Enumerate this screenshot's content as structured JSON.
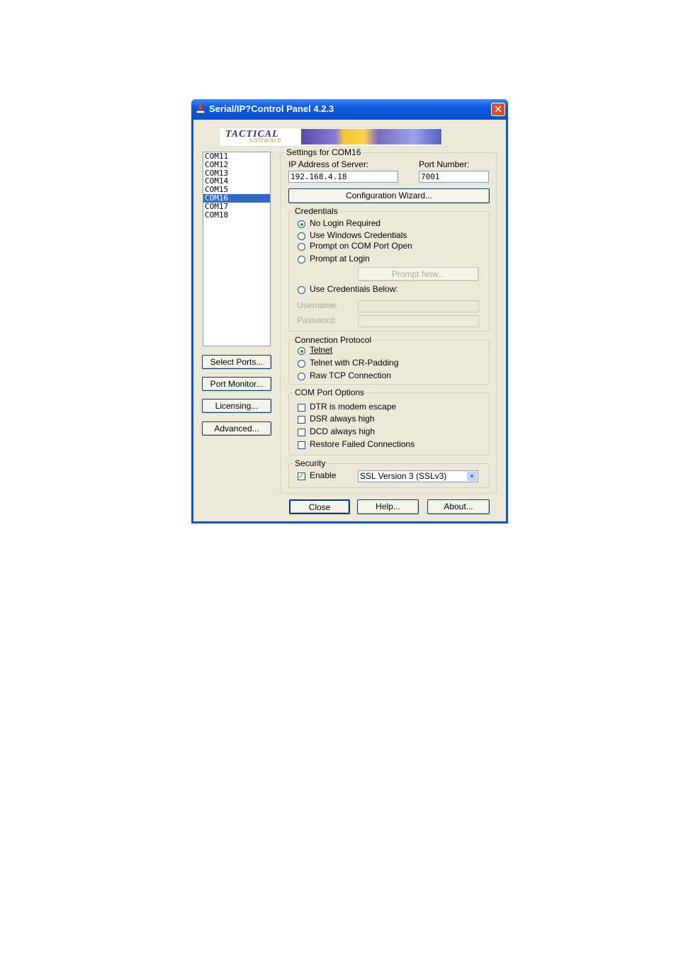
{
  "window": {
    "title": "Serial/IP?Control Panel 4.2.3",
    "close_glyph": "✕"
  },
  "logo": {
    "brand": "TACTICAL",
    "sub": "software"
  },
  "ports": {
    "items": [
      "COM11",
      "COM12",
      "COM13",
      "COM14",
      "COM15",
      "COM16",
      "COM17",
      "COM18"
    ],
    "selected": "COM16"
  },
  "left_buttons": {
    "select_ports": "Select Ports...",
    "port_monitor": "Port Monitor...",
    "licensing": "Licensing...",
    "advanced": "Advanced..."
  },
  "settings": {
    "group_label": "Settings for COM16",
    "ip_label": "IP Address of Server:",
    "ip_value": "192.168.4.18",
    "port_label": "Port Number:",
    "port_value": "7001",
    "wizard_button": "Configuration Wizard..."
  },
  "credentials": {
    "group_label": "Credentials",
    "options": [
      "No Login Required",
      "Use Windows Credentials",
      "Prompt on COM Port Open",
      "Prompt at Login"
    ],
    "selected": "No Login Required",
    "prompt_now": "Prompt Now...",
    "use_below": "Use Credentials Below:",
    "username_label": "Username:",
    "password_label": "Password:"
  },
  "protocol": {
    "group_label": "Connection Protocol",
    "options": [
      "Telnet",
      "Telnet with CR-Padding",
      "Raw TCP Connection"
    ],
    "selected": "Telnet"
  },
  "com_options": {
    "group_label": "COM Port Options",
    "items": [
      "DTR is modem escape",
      "DSR always high",
      "DCD always high",
      "Restore Failed Connections"
    ],
    "checked": [
      false,
      false,
      false,
      false
    ]
  },
  "security": {
    "group_label": "Security",
    "enable_label": "Enable",
    "enabled": true,
    "ssl_value": "SSL Version 3 (SSLv3)"
  },
  "bottom_buttons": {
    "close": "Close",
    "help": "Help...",
    "about": "About..."
  }
}
